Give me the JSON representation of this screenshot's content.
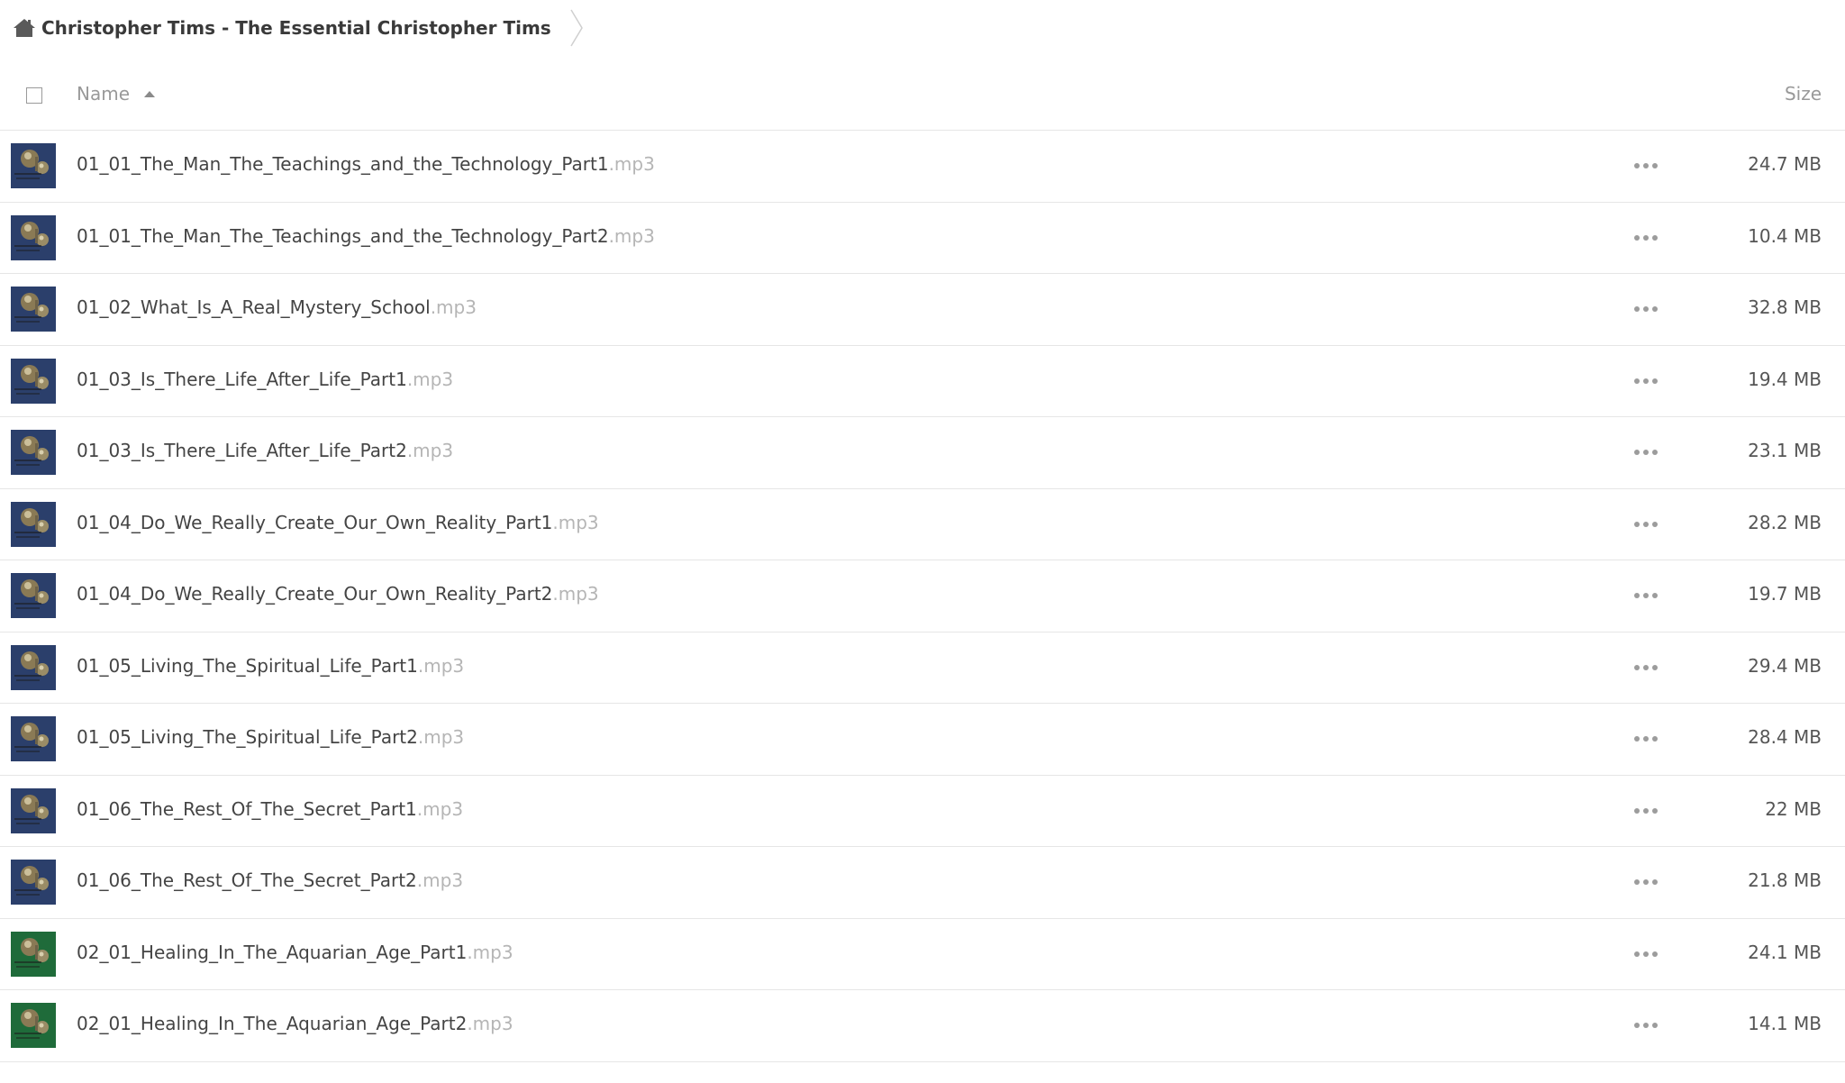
{
  "breadcrumb": {
    "icon": "home-icon",
    "title": "Christopher Tims - The Essential Christopher Tims"
  },
  "columns": {
    "name_label": "Name",
    "size_label": "Size",
    "sort_icon": "sort-ascending-icon"
  },
  "colors": {
    "thumb_blue": "#2b3f6b",
    "thumb_green": "#1f6b3a",
    "divider": "#e6e6e6",
    "muted_text": "#999999"
  },
  "files": [
    {
      "name": "01_01_The_Man_The_Teachings_and_the_Technology_Part1",
      "ext": ".mp3",
      "size": "24.7 MB",
      "thumb": "blue"
    },
    {
      "name": "01_01_The_Man_The_Teachings_and_the_Technology_Part2",
      "ext": ".mp3",
      "size": "10.4 MB",
      "thumb": "blue"
    },
    {
      "name": "01_02_What_Is_A_Real_Mystery_School",
      "ext": ".mp3",
      "size": "32.8 MB",
      "thumb": "blue"
    },
    {
      "name": "01_03_Is_There_Life_After_Life_Part1",
      "ext": ".mp3",
      "size": "19.4 MB",
      "thumb": "blue"
    },
    {
      "name": "01_03_Is_There_Life_After_Life_Part2",
      "ext": ".mp3",
      "size": "23.1 MB",
      "thumb": "blue"
    },
    {
      "name": "01_04_Do_We_Really_Create_Our_Own_Reality_Part1",
      "ext": ".mp3",
      "size": "28.2 MB",
      "thumb": "blue"
    },
    {
      "name": "01_04_Do_We_Really_Create_Our_Own_Reality_Part2",
      "ext": ".mp3",
      "size": "19.7 MB",
      "thumb": "blue"
    },
    {
      "name": "01_05_Living_The_Spiritual_Life_Part1",
      "ext": ".mp3",
      "size": "29.4 MB",
      "thumb": "blue"
    },
    {
      "name": "01_05_Living_The_Spiritual_Life_Part2",
      "ext": ".mp3",
      "size": "28.4 MB",
      "thumb": "blue"
    },
    {
      "name": "01_06_The_Rest_Of_The_Secret_Part1",
      "ext": ".mp3",
      "size": "22 MB",
      "thumb": "blue"
    },
    {
      "name": "01_06_The_Rest_Of_The_Secret_Part2",
      "ext": ".mp3",
      "size": "21.8 MB",
      "thumb": "blue"
    },
    {
      "name": "02_01_Healing_In_The_Aquarian_Age_Part1",
      "ext": ".mp3",
      "size": "24.1 MB",
      "thumb": "green"
    },
    {
      "name": "02_01_Healing_In_The_Aquarian_Age_Part2",
      "ext": ".mp3",
      "size": "14.1 MB",
      "thumb": "green"
    }
  ]
}
